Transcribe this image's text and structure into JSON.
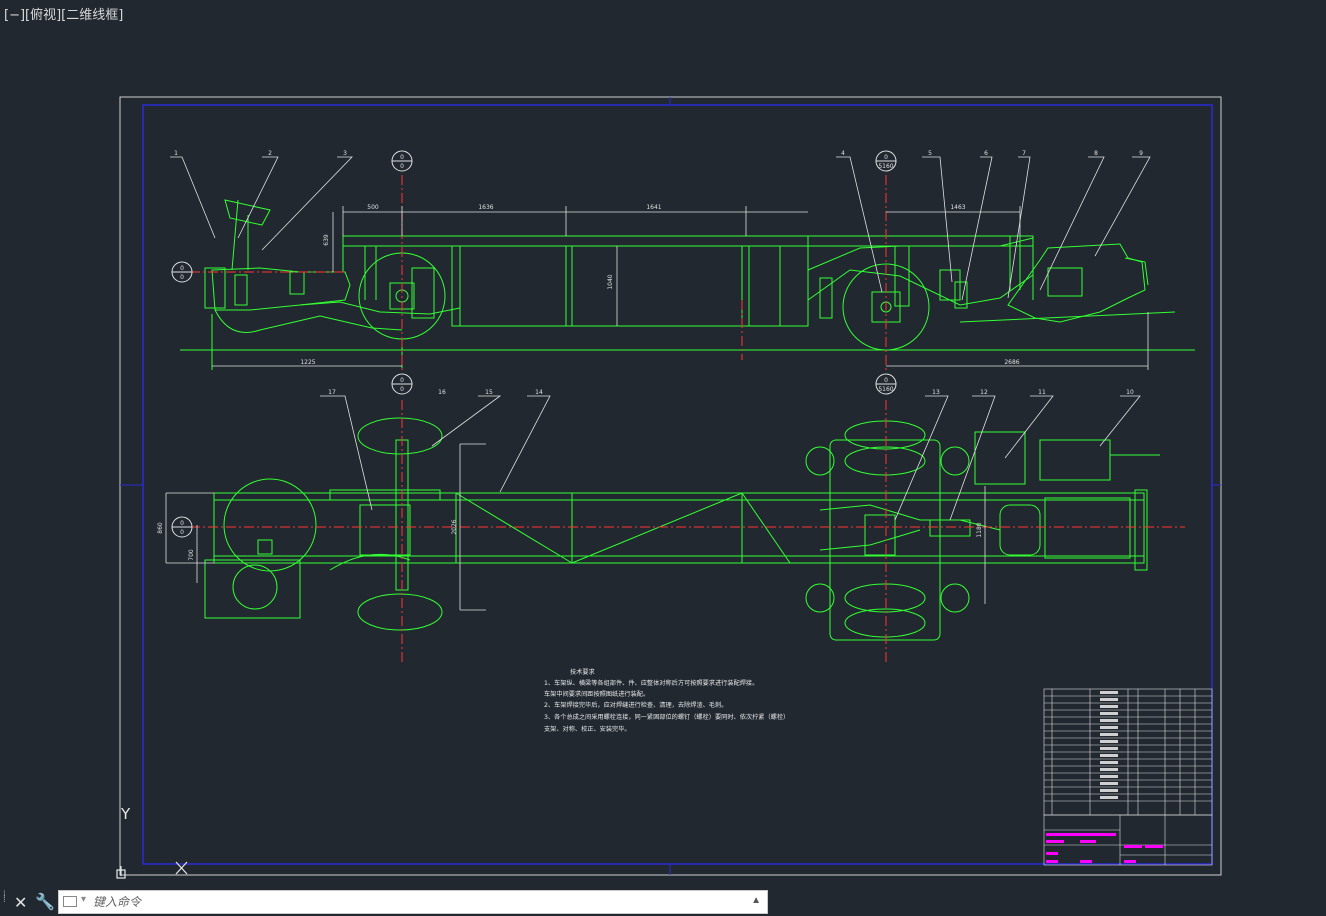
{
  "viewport": {
    "label": "[−][俯视][二维线框]"
  },
  "command_line": {
    "close_icon": "close-icon",
    "tool_icon": "wrench-icon",
    "placeholder": "键入命令"
  },
  "ucs": {
    "y_label": "Y"
  },
  "colors": {
    "background": "#212830",
    "frame_outer": "#ffffff",
    "frame_inner": "#2b2bd6",
    "geometry": "#33ff33",
    "centerline": "#ff3333",
    "dimension": "#ffffff",
    "title_block_text": "#ff00ff"
  },
  "drawing": {
    "section_marks": [
      {
        "top": "0",
        "bottom": "0"
      },
      {
        "top": "0",
        "bottom": "5160"
      },
      {
        "top": "0",
        "bottom": "0"
      },
      {
        "top": "0",
        "bottom": "0"
      },
      {
        "top": "0",
        "bottom": "0"
      },
      {
        "top": "0",
        "bottom": "5160"
      }
    ],
    "side_view_dimensions": [
      "500",
      "1636",
      "1641",
      "1463",
      "1040",
      "639",
      "1225",
      "2686"
    ],
    "top_view_dimensions": [
      "860",
      "700",
      "2026",
      "1180"
    ],
    "balloons_top_row": [
      "1",
      "2",
      "3",
      "4",
      "5",
      "6",
      "7",
      "8",
      "9"
    ],
    "balloons_plan": [
      "17",
      "16",
      "15",
      "14",
      "13",
      "12",
      "11",
      "10"
    ],
    "notes": {
      "title": "技术要求",
      "lines": [
        "1、车架纵、横梁等各组部件、件、应整体对称后方可按照要求进行装配焊接。",
        "车架中间要求间距按照图纸进行装配。",
        "2、车架焊接完毕后，应对焊缝进行检查、清理，去除焊渣、毛刺。",
        "3、各个总成之间采用螺栓连接，同一紧固部位的螺钉（螺栓）要同时、依次拧紧（螺栓）",
        "支架、对称、校正、安装完毕。"
      ]
    }
  }
}
